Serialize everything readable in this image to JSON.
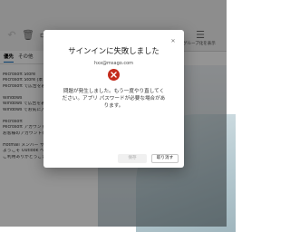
{
  "ribbon": {
    "right_label": "グループ化を表示"
  },
  "tabs": [
    {
      "label": "優先",
      "active": true
    },
    {
      "label": "その他",
      "active": false
    }
  ],
  "mail_items": [
    {
      "lines": [
        "Microsoft Store",
        "Microsoft Store (本日は…",
        "Microsoft で広告を表示…"
      ]
    },
    {
      "lines": [
        "Windows",
        "Windows で広告を表示…",
        "Windows でお気に入り…"
      ]
    },
    {
      "lines": [
        "Microsoft",
        "Microsoft アカウント…",
        "お客様のアカウントを…"
      ]
    },
    {
      "lines": [
        "Hotmail メンバー サービス",
        "ようこそ Outlook へ…",
        "ご利用ありがとうござ…"
      ]
    }
  ],
  "dialog": {
    "title": "サインインに失敗しました",
    "email": "hxx@msago.com",
    "message": "問題が発生しました。もう一度やり直してください。アプリ パスワードが必要な場合があります。",
    "primary_button": "保存",
    "retry_button": "取り消す",
    "close_glyph": "✕",
    "error_color": "#c42b1c"
  }
}
